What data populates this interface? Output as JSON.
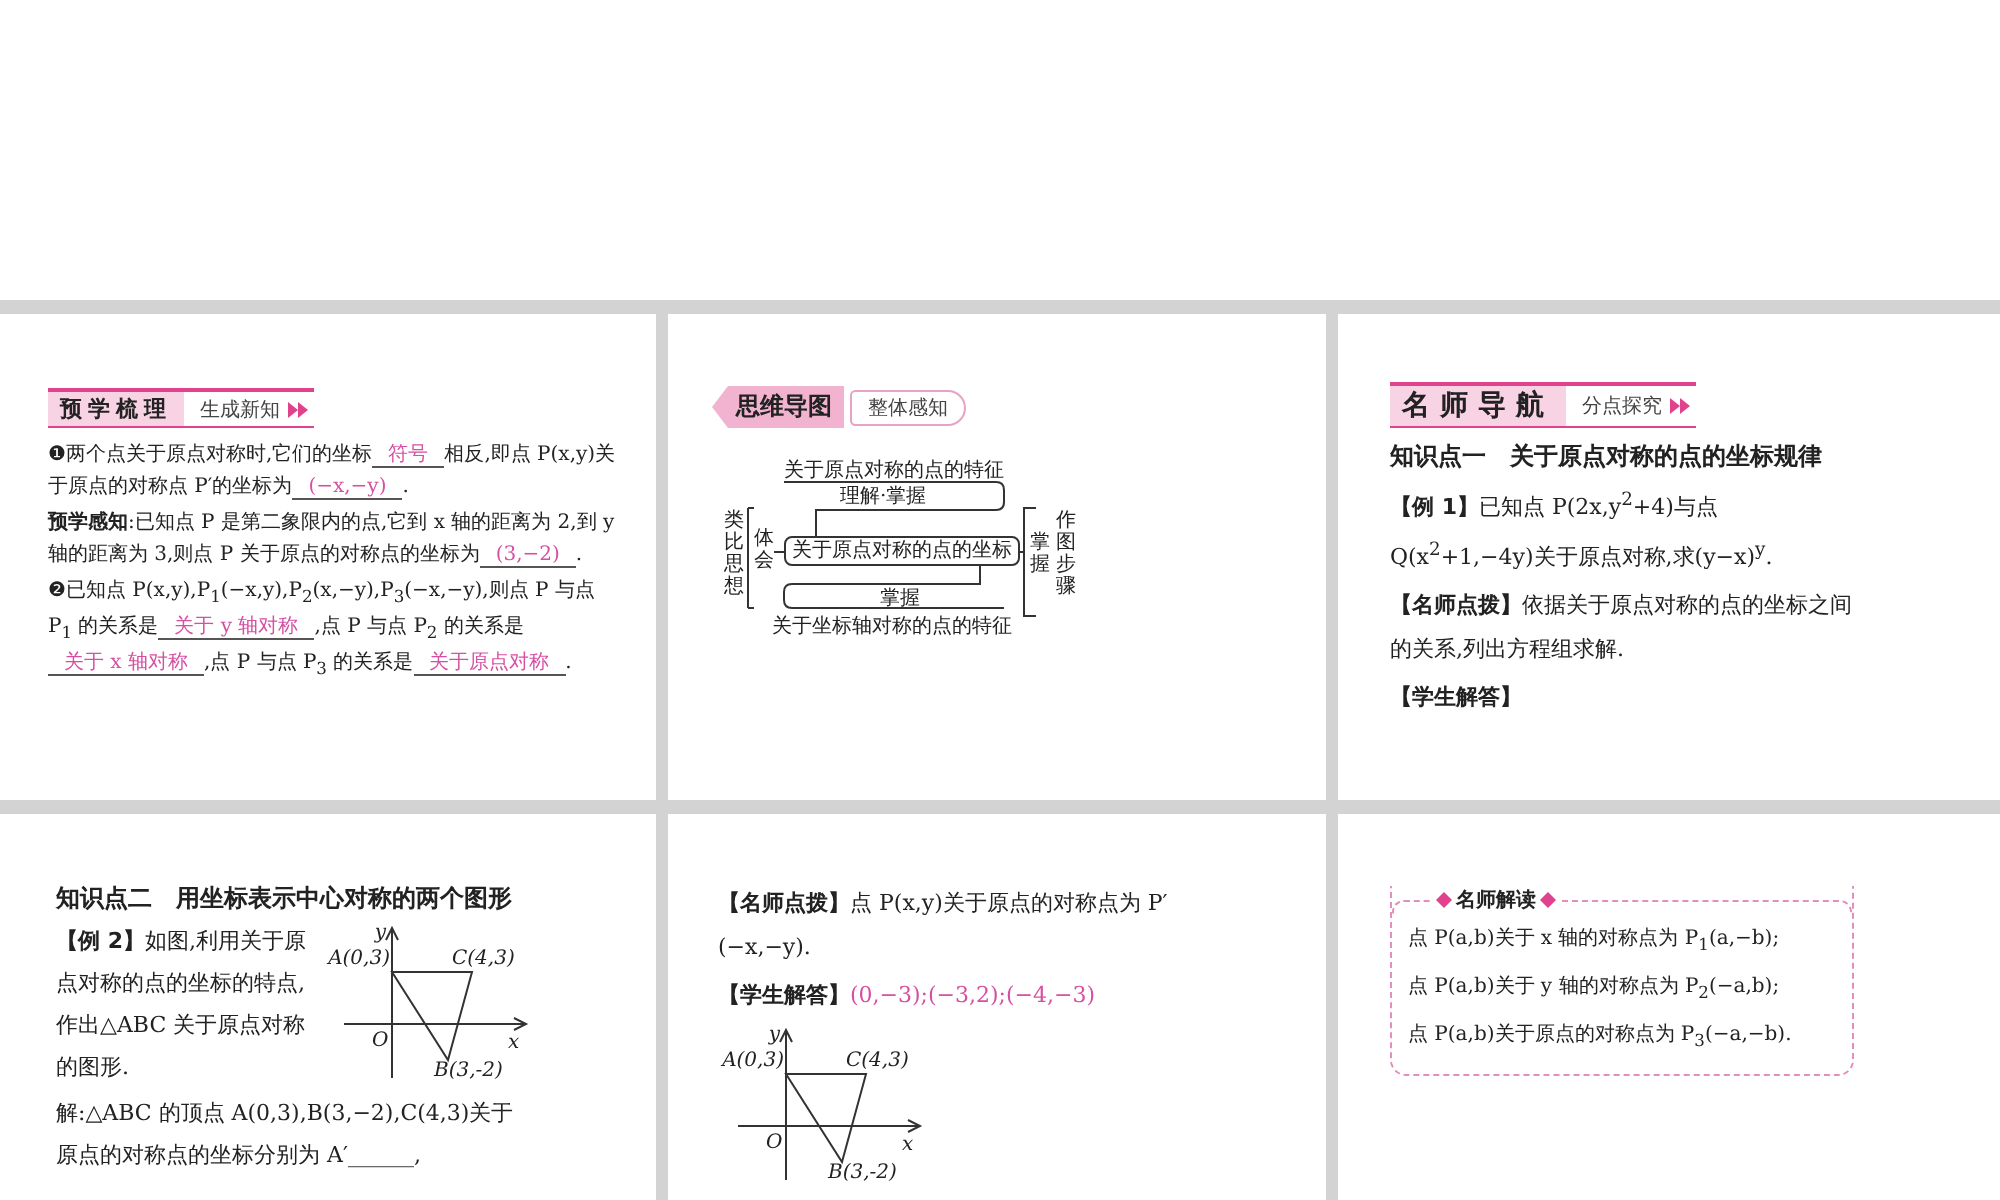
{
  "slides": [
    {
      "blocks": [
        {
          "kind": "bar_header",
          "title": "预学梳理",
          "subtitle": "生成新知"
        },
        {
          "kind": "para",
          "parts": [
            {
              "text": "❶两个点关于原点对称时,它们的坐标"
            },
            {
              "answer": "符号"
            },
            {
              "text": "相反,即点 P(x,y)关于原点的对称点 P′的坐标为"
            },
            {
              "answer": "(−x,−y)"
            },
            {
              "text": "."
            }
          ]
        },
        {
          "kind": "para",
          "parts": [
            {
              "text": "**预学感知**:已知点 P 是第二象限内的点,它到 x 轴的距离为 2,到 y 轴的距离为 3,则点 P 关于原点的对称点的坐标为"
            },
            {
              "answer": "(3,−2)"
            },
            {
              "text": "."
            }
          ]
        },
        {
          "kind": "para",
          "parts": [
            {
              "text": "❷已知点 P(x,y),P$_{1}$(−x,y),P$_{2}$(x,−y),P$_{3}$(−x,−y),则点 P 与点 P$_{1}$ 的关系是"
            },
            {
              "answer": "关于 y 轴对称"
            },
            {
              "text": ",点 P 与点 P$_{2}$ 的关系是"
            },
            {
              "answer": "关于 x 轴对称"
            },
            {
              "text": ",点 P 与点 P$_{3}$ 的关系是"
            },
            {
              "answer": "关于原点对称"
            },
            {
              "text": "."
            }
          ]
        }
      ]
    },
    {
      "blocks": [
        {
          "kind": "tag_header",
          "title": "思维导图",
          "subtitle": "整体感知"
        },
        {
          "kind": "mindmap",
          "top_label": "关于原点对称的点的特征",
          "top_note": "理解·掌握",
          "left_label": "类比思想",
          "left_note": "体会",
          "center": "关于原点对称的点的坐标",
          "right_note": "掌握",
          "right_label": "作图步骤",
          "bottom_note": "掌握",
          "bottom_label": "关于坐标轴对称的点的特征"
        }
      ]
    },
    {
      "blocks": [
        {
          "kind": "bar_header",
          "title": "名师导航",
          "subtitle": "分点探究"
        },
        {
          "kind": "heading",
          "text": "知识点一　关于原点对称的点的坐标规律"
        },
        {
          "kind": "para",
          "parts": [
            {
              "text": "**【例 1】**已知点 P(2x,y$^{2}$+4)与点 Q(x$^{2}$+1,−4y)关于原点对称,求(y−x)$^{y}$."
            }
          ]
        },
        {
          "kind": "para",
          "parts": [
            {
              "text": "**【名师点拨】**依据关于原点对称的点的坐标之间的关系,列出方程组求解."
            }
          ]
        },
        {
          "kind": "label",
          "text": "【学生解答】"
        }
      ]
    },
    {
      "blocks": [
        {
          "kind": "heading",
          "text": "知识点二　用坐标表示中心对称的两个图形"
        },
        {
          "kind": "example",
          "text": "**【例 2】**如图,利用关于原点对称的点的坐标的特点,作出△ABC 关于原点对称的图形.",
          "labels": [
            "y",
            "A(0,3)",
            "C(4,3)",
            "O",
            "x",
            "B(3,-2)"
          ]
        },
        {
          "kind": "para",
          "parts": [
            {
              "text": "解:△ABC 的顶点 A(0,3),B(3,−2),C(4,3)关于原点的对称点的坐标分别为 A′______,"
            }
          ]
        }
      ]
    },
    {
      "blocks": [
        {
          "kind": "para",
          "parts": [
            {
              "text": "**【名师点拨】**点 P(x,y)关于原点的对称点为 P′(−x,−y)."
            }
          ]
        },
        {
          "kind": "label",
          "text": "【学生解答】",
          "answer": "(0,−3);(−3,2);(−4,−3)"
        },
        {
          "kind": "figure",
          "labels": [
            "y",
            "A(0,3)",
            "C(4,3)",
            "O",
            "x",
            "B(3,-2)"
          ]
        }
      ]
    },
    {
      "blocks": [
        {
          "kind": "callout",
          "title": "名师解读",
          "lines": [
            "点 P(a,b)关于 x 轴的对称点为 P$_{1}$(a,−b);",
            "点 P(a,b)关于 y 轴的对称点为 P$_{2}$(−a,b);",
            "点 P(a,b)关于原点的对称点为 P$_{3}$(−a,−b)."
          ]
        }
      ]
    }
  ]
}
